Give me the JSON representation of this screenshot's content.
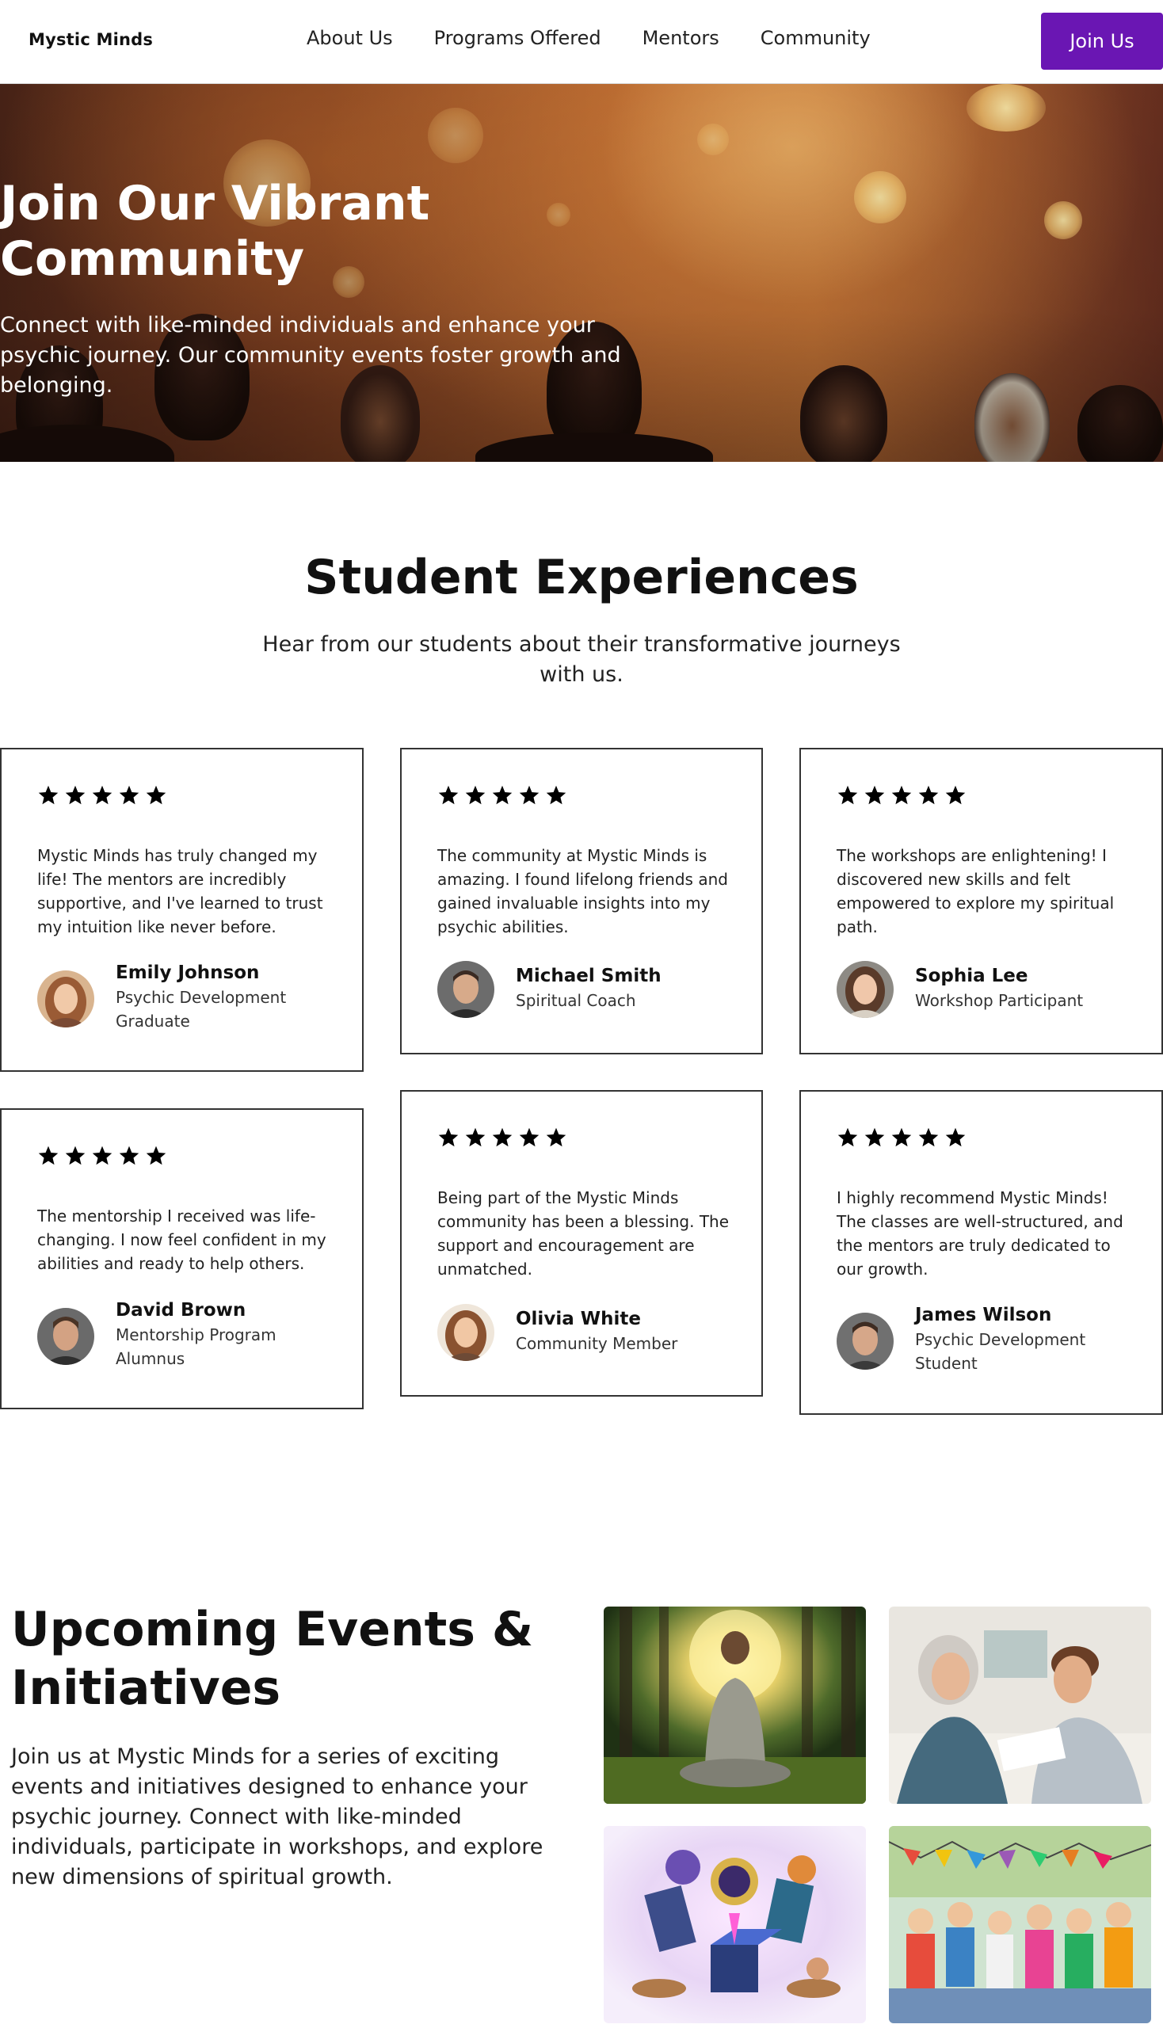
{
  "nav": {
    "logo": "Mystic Minds",
    "links": [
      "About Us",
      "Programs Offered",
      "Mentors",
      "Community"
    ],
    "cta": "Join Us"
  },
  "hero": {
    "title": "Join Our Vibrant Community",
    "subtitle": "Connect with like-minded individuals and enhance your psychic journey. Our community events foster growth and belonging."
  },
  "testimonials": {
    "title": "Student Experiences",
    "subtitle": "Hear from our students about their transformative journeys with us.",
    "items": [
      {
        "rating": 5,
        "quote": "Mystic Minds has truly changed my life! The mentors are incredibly supportive, and I've learned to trust my intuition like never before.",
        "name": "Emily Johnson",
        "role": "Psychic Development Graduate"
      },
      {
        "rating": 5,
        "quote": "The community at Mystic Minds is amazing. I found lifelong friends and gained invaluable insights into my psychic abilities.",
        "name": "Michael Smith",
        "role": "Spiritual Coach"
      },
      {
        "rating": 5,
        "quote": "The workshops are enlightening! I discovered new skills and felt empowered to explore my spiritual path.",
        "name": "Sophia Lee",
        "role": "Workshop Participant"
      },
      {
        "rating": 5,
        "quote": "The mentorship I received was life-changing. I now feel confident in my abilities and ready to help others.",
        "name": "David Brown",
        "role": "Mentorship Program Alumnus"
      },
      {
        "rating": 5,
        "quote": "Being part of the Mystic Minds community has been a blessing. The support and encouragement are unmatched.",
        "name": "Olivia White",
        "role": "Community Member"
      },
      {
        "rating": 5,
        "quote": "I highly recommend Mystic Minds! The classes are well-structured, and the mentors are truly dedicated to our growth.",
        "name": "James Wilson",
        "role": "Psychic Development Student"
      }
    ]
  },
  "events": {
    "title": "Upcoming Events & Initiatives",
    "text": "Join us at Mystic Minds for a series of exciting events and initiatives designed to enhance your psychic journey. Connect with like-minded individuals, participate in workshops, and explore new dimensions of spiritual growth."
  },
  "colors": {
    "accent": "#6a16b3",
    "text": "#111111",
    "card_border": "#333333"
  }
}
